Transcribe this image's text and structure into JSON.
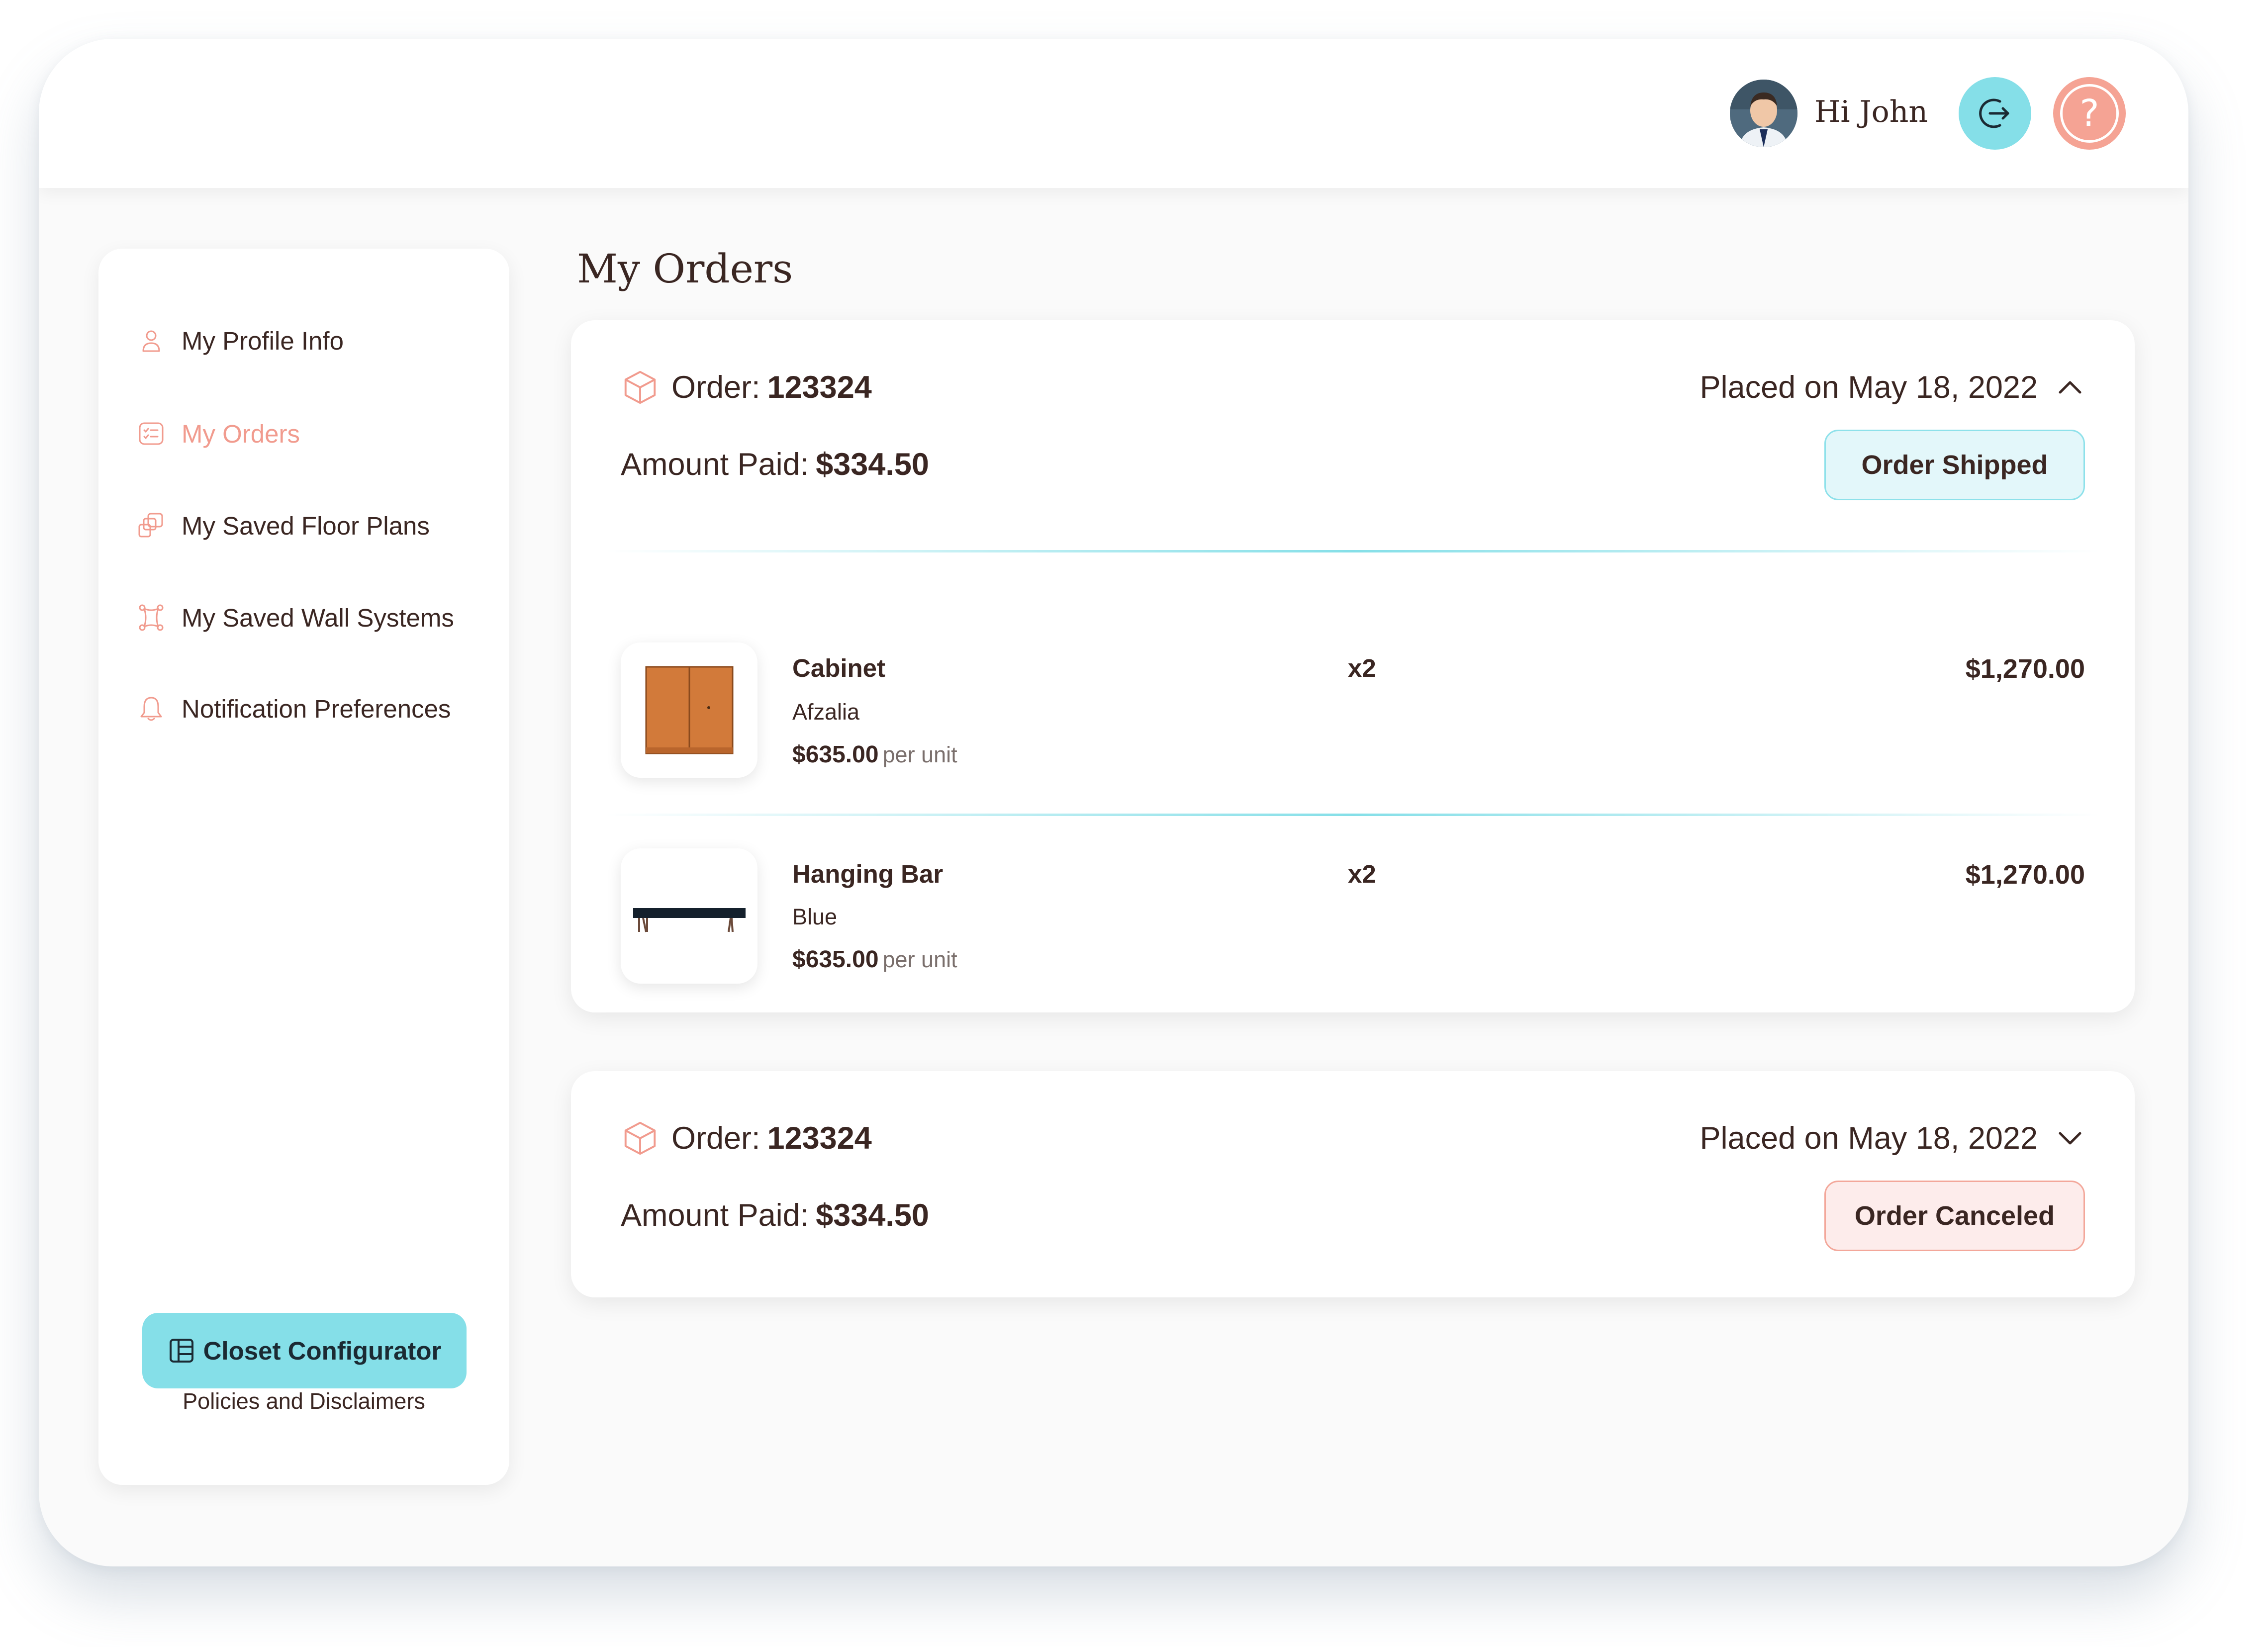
{
  "header": {
    "greeting": "Hi John",
    "logout_icon": "logout-arrow-icon",
    "help_icon": "question-icon",
    "help_glyph": "?"
  },
  "sidebar": {
    "items": [
      {
        "label": "My Profile Info",
        "icon": "user-icon",
        "active": false
      },
      {
        "label": "My Orders",
        "icon": "orders-list-icon",
        "active": true
      },
      {
        "label": "My Saved Floor Plans",
        "icon": "floor-plans-icon",
        "active": false
      },
      {
        "label": "My Saved Wall Systems",
        "icon": "wall-systems-icon",
        "active": false
      },
      {
        "label": "Notification Preferences",
        "icon": "bell-icon",
        "active": false
      }
    ],
    "configurator_label": "Closet Configurator",
    "policies_label": "Policies and Disclaimers"
  },
  "main": {
    "title": "My Orders",
    "orders": [
      {
        "order_label": "Order:",
        "order_number": "123324",
        "amount_label": "Amount Paid:",
        "amount": "$334.50",
        "placed": "Placed on May 18, 2022",
        "status": "Order Shipped",
        "expanded": true,
        "items": [
          {
            "name": "Cabinet",
            "variant": "Afzalia",
            "unit_price": "$635.00",
            "per_unit": "per unit",
            "qty": "x2",
            "total": "$1,270.00"
          },
          {
            "name": "Hanging Bar",
            "variant": "Blue",
            "unit_price": "$635.00",
            "per_unit": "per unit",
            "qty": "x2",
            "total": "$1,270.00"
          }
        ]
      },
      {
        "order_label": "Order:",
        "order_number": "123324",
        "amount_label": "Amount Paid:",
        "amount": "$334.50",
        "placed": "Placed on May 18, 2022",
        "status": "Order Canceled",
        "expanded": false
      }
    ]
  },
  "colors": {
    "accent_teal": "#85dfe8",
    "accent_coral": "#f19b8e",
    "text_dark": "#3a2622",
    "shipped_bg": "#e3f7fa",
    "canceled_bg": "#fdeceb"
  }
}
